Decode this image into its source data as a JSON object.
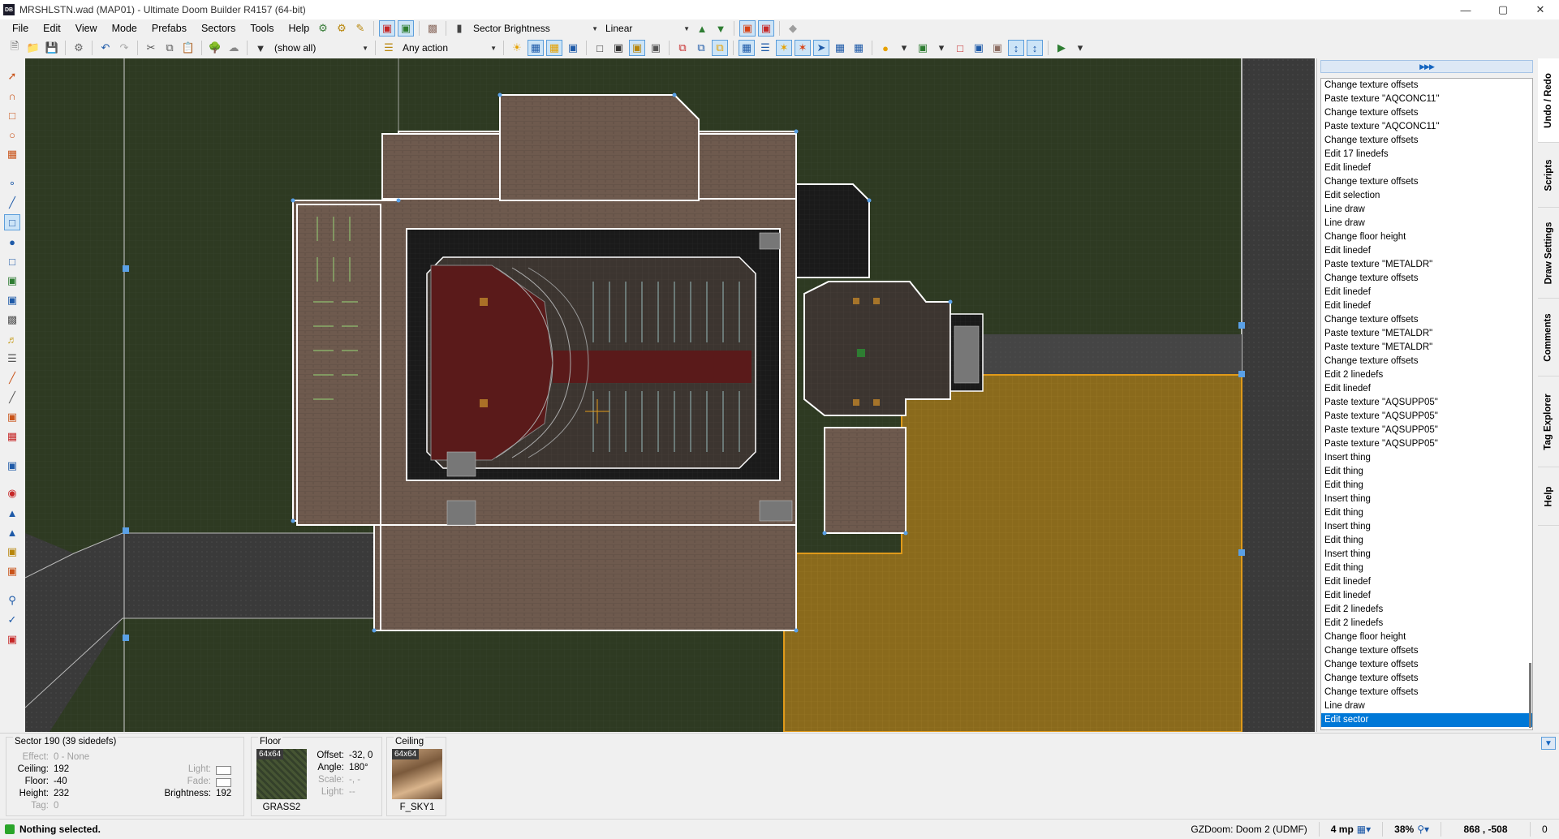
{
  "window": {
    "app_icon": "DB",
    "title": "MRSHLSTN.wad (MAP01) - Ultimate Doom Builder R4157 (64-bit)",
    "controls": [
      "minimize-icon",
      "maximize-icon",
      "close-icon"
    ]
  },
  "menu": [
    "File",
    "Edit",
    "View",
    "Mode",
    "Prefabs",
    "Sectors",
    "Tools",
    "Help"
  ],
  "toolbar": {
    "view_mode": "Sector Brightness",
    "interpolation": "Linear",
    "thing_filter": "(show all)",
    "linedef_action": "Any action"
  },
  "undo_list": {
    "items": [
      "Change texture offsets",
      "Paste texture \"AQCONC11\"",
      "Change texture offsets",
      "Paste texture \"AQCONC11\"",
      "Change texture offsets",
      "Edit 17 linedefs",
      "Edit linedef",
      "Change texture offsets",
      "Edit selection",
      "Line draw",
      "Line draw",
      "Change floor height",
      "Edit linedef",
      "Paste texture \"METALDR\"",
      "Change texture offsets",
      "Edit linedef",
      "Edit linedef",
      "Change texture offsets",
      "Paste texture \"METALDR\"",
      "Paste texture \"METALDR\"",
      "Change texture offsets",
      "Edit 2 linedefs",
      "Edit linedef",
      "Paste texture \"AQSUPP05\"",
      "Paste texture \"AQSUPP05\"",
      "Paste texture \"AQSUPP05\"",
      "Paste texture \"AQSUPP05\"",
      "Insert thing",
      "Edit thing",
      "Edit thing",
      "Insert thing",
      "Edit thing",
      "Insert thing",
      "Edit thing",
      "Insert thing",
      "Edit thing",
      "Edit linedef",
      "Edit linedef",
      "Edit 2 linedefs",
      "Edit 2 linedefs",
      "Change floor height",
      "Change texture offsets",
      "Change texture offsets",
      "Change texture offsets",
      "Change texture offsets",
      "Line draw",
      "Edit sector"
    ],
    "selected_index": 46
  },
  "side_tabs": [
    "Undo / Redo",
    "Scripts",
    "Draw Settings",
    "Comments",
    "Tag Explorer",
    "Help"
  ],
  "sector_info": {
    "header": "Sector 190 (39 sidedefs)",
    "effect_label": "Effect:",
    "effect": "0 - None",
    "ceiling_label": "Ceiling:",
    "ceiling": "192",
    "floor_label": "Floor:",
    "floor": "-40",
    "height_label": "Height:",
    "height": "232",
    "tag_label": "Tag:",
    "tag": "0",
    "light_label": "Light:",
    "fade_label": "Fade:",
    "brightness_label": "Brightness:",
    "brightness": "192"
  },
  "floor_panel": {
    "title": "Floor",
    "size": "64x64",
    "texture": "GRASS2",
    "offset_label": "Offset:",
    "offset": "-32, 0",
    "angle_label": "Angle:",
    "angle": "180°",
    "scale_label": "Scale:",
    "scale": "-, -",
    "light_label": "Light:",
    "light": "--"
  },
  "ceiling_panel": {
    "title": "Ceiling",
    "size": "64x64",
    "texture": "F_SKY1"
  },
  "status": {
    "message": "Nothing selected.",
    "engine": "GZDoom: Doom 2 (UDMF)",
    "grid": "4 mp",
    "zoom": "38%",
    "coords": "868 , -508",
    "count": "0"
  },
  "colors": {
    "accent": "#0078d7",
    "grass": "#2e3a22",
    "selected_sector": "#8a6a1c",
    "wall": "#ffffff",
    "vertex": "#5aa0e6"
  }
}
